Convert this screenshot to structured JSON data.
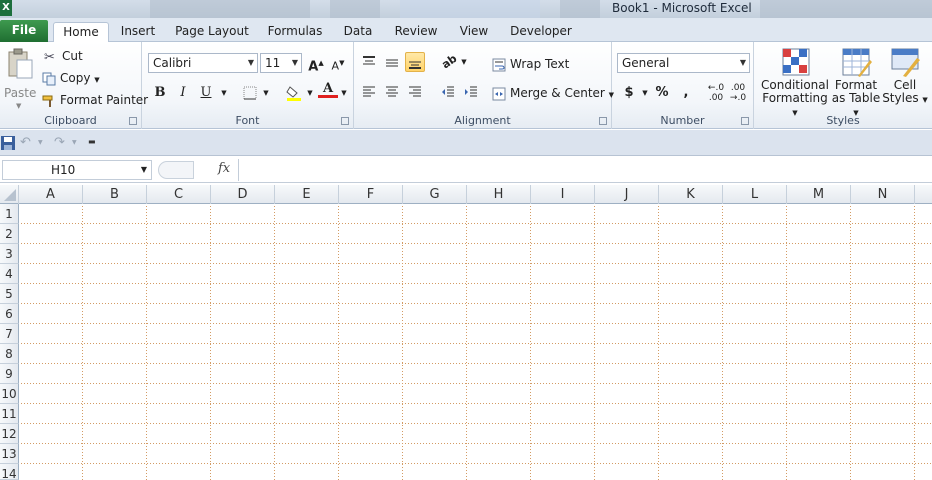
{
  "window": {
    "title": "Book1  -  Microsoft Excel",
    "app_icon": "X"
  },
  "tabs": [
    {
      "label": "File"
    },
    {
      "label": "Home"
    },
    {
      "label": "Insert"
    },
    {
      "label": "Page Layout"
    },
    {
      "label": "Formulas"
    },
    {
      "label": "Data"
    },
    {
      "label": "Review"
    },
    {
      "label": "View"
    },
    {
      "label": "Developer"
    }
  ],
  "clipboard": {
    "paste": "Paste",
    "cut": "Cut",
    "copy": "Copy",
    "format_painter": "Format Painter",
    "label": "Clipboard"
  },
  "font": {
    "name": "Calibri",
    "size": "11",
    "label": "Font",
    "bold": "B",
    "italic": "I",
    "underline": "U",
    "font_color": "A"
  },
  "alignment": {
    "wrap_text": "Wrap Text",
    "merge_center": "Merge & Center",
    "label": "Alignment"
  },
  "number": {
    "format": "General",
    "currency": "$",
    "percent": "%",
    "comma": ",",
    "inc_decimal": ".0→.00",
    "label": "Number"
  },
  "styles": {
    "conditional1": "Conditional",
    "conditional2": "Formatting",
    "table1": "Format",
    "table2": "as Table",
    "cell1": "Cell",
    "cell2": "Styles",
    "label": "Styles"
  },
  "formula_bar": {
    "name_box": "H10",
    "fx": "fx",
    "value": ""
  },
  "columns": [
    "A",
    "B",
    "C",
    "D",
    "E",
    "F",
    "G",
    "H",
    "I",
    "J",
    "K",
    "L",
    "M",
    "N"
  ],
  "rows": [
    "1",
    "2",
    "3",
    "4",
    "5",
    "6",
    "7",
    "8",
    "9",
    "10",
    "11",
    "12",
    "13",
    "14"
  ]
}
